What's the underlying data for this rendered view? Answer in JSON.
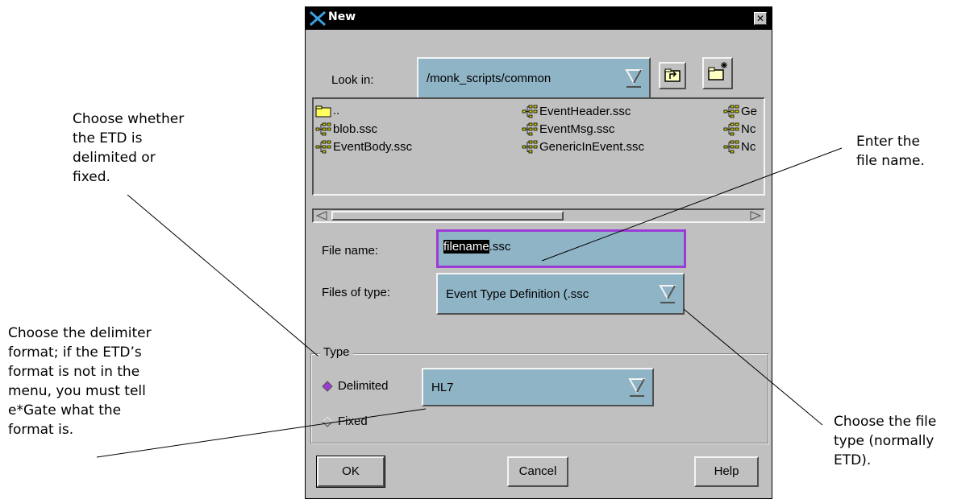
{
  "dialog": {
    "title": "New",
    "look_in_label": "Look in:",
    "look_in_value": "/monk_scripts/common",
    "files": [
      {
        "name": "..",
        "type": "folder"
      },
      {
        "name": "blob.ssc",
        "type": "etd"
      },
      {
        "name": "EventBody.ssc",
        "type": "etd"
      },
      {
        "name": "EventHeader.ssc",
        "type": "etd"
      },
      {
        "name": "EventMsg.ssc",
        "type": "etd"
      },
      {
        "name": "GenericInEvent.ssc",
        "type": "etd"
      },
      {
        "name": "Ge",
        "type": "etd"
      },
      {
        "name": "Nc",
        "type": "etd"
      },
      {
        "name": "Nc",
        "type": "etd"
      }
    ],
    "file_name_label": "File name:",
    "file_name_selected": "filename",
    "file_name_rest": ".ssc",
    "files_of_type_label": "Files of type:",
    "files_of_type_value": "Event Type Definition (.ssc",
    "type_group_label": "Type",
    "delimited_label": "Delimited",
    "delimited_selected": true,
    "delimiter_value": "HL7",
    "fixed_label": "Fixed",
    "ok_label": "OK",
    "cancel_label": "Cancel",
    "help_label": "Help"
  },
  "callouts": {
    "delimited_or_fixed": [
      "Choose whether",
      "the ETD is",
      "delimited or",
      "fixed."
    ],
    "delimiter_format": [
      "Choose the delimiter",
      "format; if the ETD’s",
      "format is not in the",
      "menu, you must tell",
      "e*Gate what the",
      "format is."
    ],
    "file_name": [
      "Enter the",
      "file name."
    ],
    "file_type": [
      "Choose the file",
      "type (normally",
      "ETD)."
    ]
  },
  "colors": {
    "field_bg": "#8fb4c6",
    "focus_border": "#9c3cd6",
    "dialog_bg": "#c0c0c0",
    "radio_selected": "#9c3cd6"
  }
}
